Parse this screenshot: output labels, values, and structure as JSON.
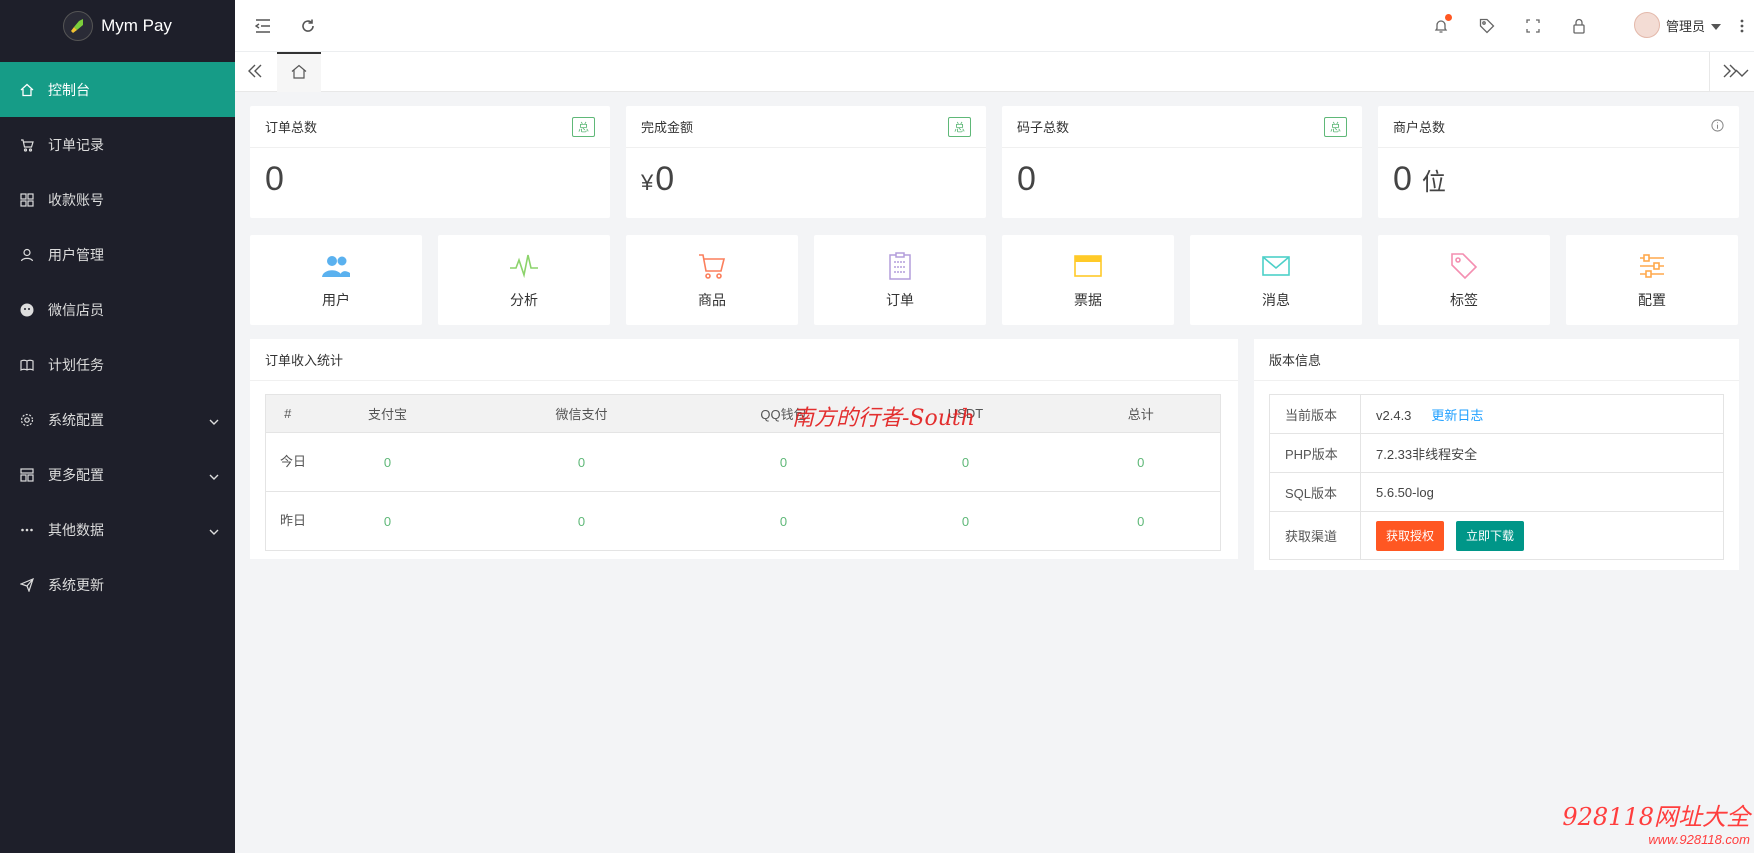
{
  "app": {
    "name": "Mym Pay"
  },
  "sidebar": {
    "items": [
      {
        "label": "控制台",
        "icon": "home-icon",
        "active": true
      },
      {
        "label": "订单记录",
        "icon": "cart-icon"
      },
      {
        "label": "收款账号",
        "icon": "apps-icon"
      },
      {
        "label": "用户管理",
        "icon": "user-icon"
      },
      {
        "label": "微信店员",
        "icon": "wechat-icon"
      },
      {
        "label": "计划任务",
        "icon": "book-icon"
      },
      {
        "label": "系统配置",
        "icon": "gear-icon",
        "expandable": true
      },
      {
        "label": "更多配置",
        "icon": "template-icon",
        "expandable": true
      },
      {
        "label": "其他数据",
        "icon": "more-icon",
        "expandable": true
      },
      {
        "label": "系统更新",
        "icon": "send-icon"
      }
    ]
  },
  "header": {
    "admin_name": "管理员"
  },
  "stats": [
    {
      "title": "订单总数",
      "badge": "总",
      "value": "0"
    },
    {
      "title": "完成金额",
      "badge": "总",
      "currency": "¥",
      "value": "0"
    },
    {
      "title": "码子总数",
      "badge": "总",
      "value": "0"
    },
    {
      "title": "商户总数",
      "value": "0",
      "unit": "位"
    }
  ],
  "shortcuts": [
    {
      "label": "用户",
      "icon": "users-icon",
      "color": "#5ab1ef"
    },
    {
      "label": "分析",
      "icon": "pulse-icon",
      "color": "#8cd36b"
    },
    {
      "label": "商品",
      "icon": "cart-icon",
      "color": "#fb7f5c"
    },
    {
      "label": "订单",
      "icon": "clipboard-icon",
      "color": "#b39ddb"
    },
    {
      "label": "票据",
      "icon": "card-icon",
      "color": "#ffca28"
    },
    {
      "label": "消息",
      "icon": "mail-icon",
      "color": "#4dd0c8"
    },
    {
      "label": "标签",
      "icon": "tag-icon",
      "color": "#f48fb1"
    },
    {
      "label": "配置",
      "icon": "sliders-icon",
      "color": "#ffa94d"
    }
  ],
  "income": {
    "title": "订单收入统计",
    "headers": [
      "#",
      "支付宝",
      "微信支付",
      "QQ钱包",
      "USDT",
      "总计"
    ],
    "rows": [
      {
        "label": "今日",
        "values": [
          "0",
          "0",
          "0",
          "0",
          "0"
        ]
      },
      {
        "label": "昨日",
        "values": [
          "0",
          "0",
          "0",
          "0",
          "0"
        ]
      }
    ]
  },
  "version": {
    "title": "版本信息",
    "current_label": "当前版本",
    "current_value": "v2.4.3",
    "changelog": "更新日志",
    "php_label": "PHP版本",
    "php_value": "7.2.33非线程安全",
    "sql_label": "SQL版本",
    "sql_value": "5.6.50-log",
    "channel_label": "获取渠道",
    "btn_auth": "获取授权",
    "btn_download": "立即下载"
  },
  "watermarks": {
    "center": "南方的行者-South",
    "corner_big": "928118网址大全",
    "corner_small": "www.928118.com"
  },
  "colors": {
    "sidebar_bg": "#1e1f2a",
    "active": "#169c87",
    "green": "#5fb878",
    "orange": "#ff5722",
    "teal": "#009688",
    "blue_link": "#1e9fff"
  }
}
